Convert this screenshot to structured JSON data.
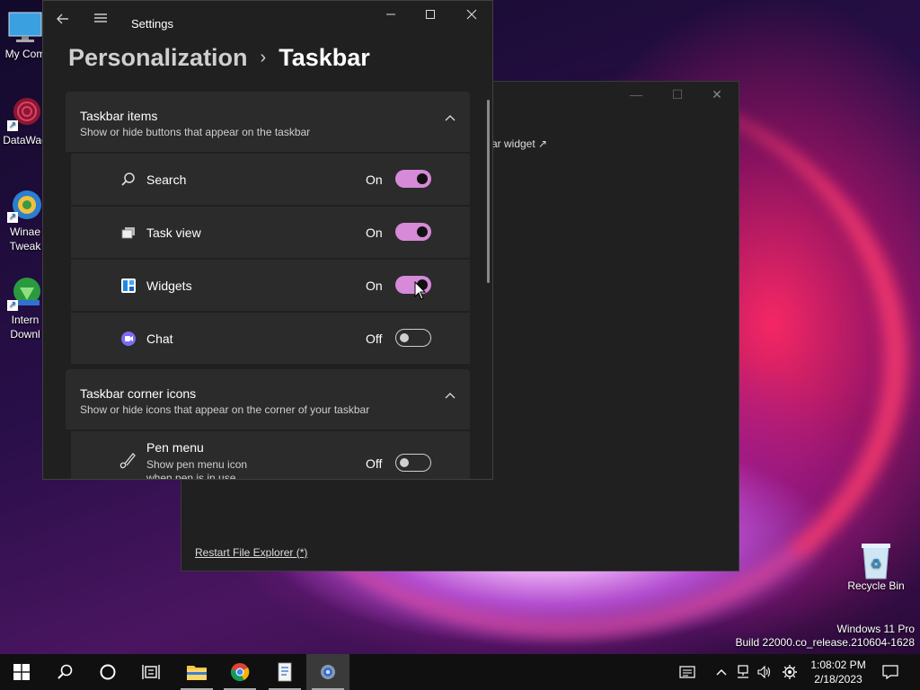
{
  "desktop": {
    "icons": [
      {
        "label": "My Com"
      },
      {
        "label": "DataWag"
      },
      {
        "label_line1": "Winae",
        "label_line2": "Tweak"
      },
      {
        "label_line1": "Intern",
        "label_line2": "Downl"
      }
    ],
    "recycle_bin": "Recycle Bin",
    "watermark_line1": "Windows 11 Pro",
    "watermark_line2": "Build 22000.co_release.210604-1628"
  },
  "winaero_window": {
    "widget_link": "ar widget ↗",
    "restart_link": "Restart File Explorer (*)"
  },
  "settings": {
    "title": "Settings",
    "breadcrumb_parent": "Personalization",
    "breadcrumb_sep": "›",
    "breadcrumb_current": "Taskbar",
    "sections": [
      {
        "title": "Taskbar items",
        "subtitle": "Show or hide buttons that appear on the taskbar",
        "items": [
          {
            "label": "Search",
            "state": "On",
            "on": true,
            "icon": "search-icon"
          },
          {
            "label": "Task view",
            "state": "On",
            "on": true,
            "icon": "task-view-icon"
          },
          {
            "label": "Widgets",
            "state": "On",
            "on": true,
            "icon": "widgets-icon"
          },
          {
            "label": "Chat",
            "state": "Off",
            "on": false,
            "icon": "chat-icon"
          }
        ]
      },
      {
        "title": "Taskbar corner icons",
        "subtitle": "Show or hide icons that appear on the corner of your taskbar",
        "items": [
          {
            "label": "Pen menu",
            "desc_line1": "Show pen menu icon",
            "desc_line2": "when pen is in use",
            "state": "Off",
            "on": false,
            "icon": "pen-icon"
          }
        ]
      }
    ]
  },
  "taskbar": {
    "time": "1:08:02 PM",
    "date": "2/18/2023"
  },
  "colors": {
    "toggle_on": "#d68ad8",
    "window_bg": "#202020",
    "card_bg": "#2b2b2b"
  }
}
